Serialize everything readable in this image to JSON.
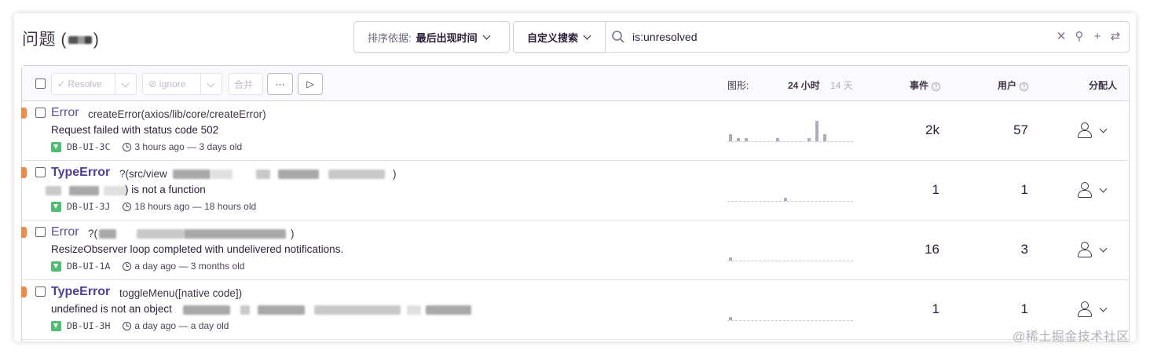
{
  "header": {
    "title": "问题",
    "title_paren_open": "(",
    "title_paren_close": ")",
    "sort_label": "排序依据:",
    "sort_value": "最后出现时间",
    "custom_search_label": "自定义搜索",
    "search_query": "is:unresolved"
  },
  "toolbar": {
    "resolve_label": "✓ Resolve",
    "ignore_label": "⊘ Ignore",
    "merge_label": "合并",
    "more_label": "···",
    "play_label": "▷"
  },
  "columns": {
    "graph_label": "图形:",
    "period_24h": "24 小时",
    "period_14d": "14 天",
    "events_label": "事件",
    "users_label": "用户",
    "assignee_label": "分配人"
  },
  "issues": [
    {
      "type": "Error",
      "culprit": "createError(axios/lib/core/createError)",
      "message": "Request failed with status code 502",
      "short_id": "DB-UI-3C",
      "time": "3 hours ago — 3 days old",
      "events": "2k",
      "users": "57"
    },
    {
      "type": "TypeError",
      "culprit": "?(src/view",
      "culprit_end": ")",
      "message": ") is not a function",
      "short_id": "DB-UI-3J",
      "time": "18 hours ago — 18 hours old",
      "events": "1",
      "users": "1"
    },
    {
      "type": "Error",
      "culprit": "?(",
      "culprit_end": ")",
      "message": "ResizeObserver loop completed with undelivered notifications.",
      "short_id": "DB-UI-1A",
      "time": "a day ago — 3 months old",
      "events": "16",
      "users": "3"
    },
    {
      "type": "TypeError",
      "culprit": "toggleMenu([native code])",
      "message": "undefined is not an object",
      "short_id": "DB-UI-3H",
      "time": "a day ago — a day old",
      "events": "1",
      "users": "1"
    }
  ],
  "sparklines": [
    [
      2,
      1,
      1,
      0,
      0,
      0,
      1,
      0,
      0,
      0,
      1,
      6,
      2,
      0,
      0,
      0
    ],
    [
      0,
      0,
      0,
      0,
      0,
      0,
      0,
      1,
      0,
      0,
      0,
      0,
      0,
      0,
      0,
      0
    ],
    [
      1,
      0,
      0,
      0,
      0,
      0,
      0,
      0,
      0,
      0,
      0,
      0,
      0,
      0,
      0,
      0
    ],
    [
      1,
      0,
      0,
      0,
      0,
      0,
      0,
      0,
      0,
      0,
      0,
      0,
      0,
      0,
      0,
      0
    ]
  ],
  "watermark": "@稀土掘金技术社区",
  "colors": {
    "level_error": "#f18a45",
    "title_link": "#5b4d9f",
    "platform_badge": "#4fbd72"
  }
}
